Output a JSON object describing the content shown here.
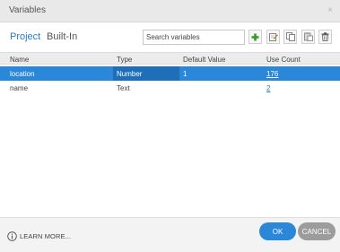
{
  "window": {
    "title": "Variables",
    "close_glyph": "×"
  },
  "tabs": [
    {
      "label": "Project",
      "active": true
    },
    {
      "label": "Built-In",
      "active": false
    }
  ],
  "search": {
    "placeholder": "Search variables",
    "value": ""
  },
  "toolbar": {
    "icons": [
      "add-icon",
      "edit-icon",
      "copy-icon",
      "paste-icon",
      "delete-icon"
    ],
    "add_color": "#3a9a2e"
  },
  "table": {
    "columns": [
      "Name",
      "Type",
      "Default Value",
      "Use Count"
    ],
    "rows": [
      {
        "name": "location",
        "type": "Number",
        "default": "1",
        "use_count": "176",
        "selected": true
      },
      {
        "name": "name",
        "type": "Text",
        "default": "",
        "use_count": "2",
        "selected": false
      }
    ]
  },
  "footer": {
    "learn_more": "LEARN MORE...",
    "ok_label": "OK",
    "cancel_label": "CANCEL"
  },
  "colors": {
    "accent": "#2b87d8",
    "selected_row": "#2b87d8",
    "cancel": "#9c9c9c"
  }
}
